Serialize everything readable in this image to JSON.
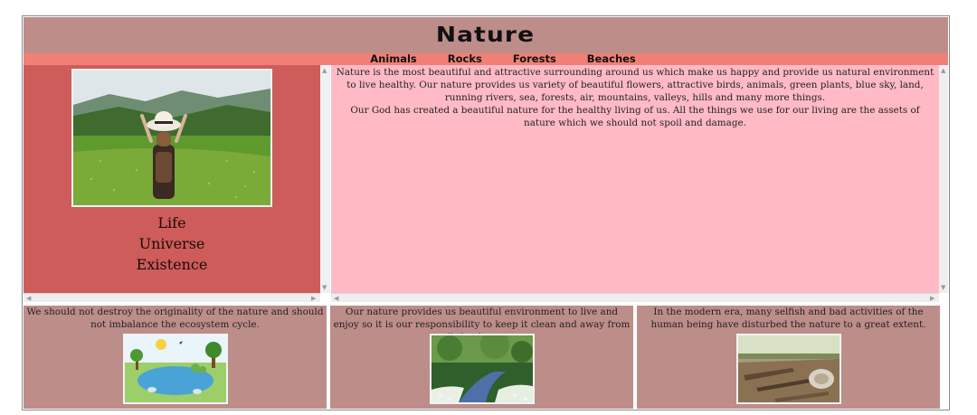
{
  "page": {
    "title": "Nature"
  },
  "nav": {
    "items": [
      "Animals",
      "Rocks",
      "Forests",
      "Beaches"
    ]
  },
  "left": {
    "image_icon": "woman-in-meadow-photo",
    "lines": [
      "Life",
      "Universe",
      "Existence"
    ]
  },
  "main": {
    "paragraph1": "Nature is the most beautiful and attractive surrounding around us which make us happy and provide us natural environment to live healthy. Our nature provides us variety of beautiful flowers, attractive birds, animals, green plants, blue sky, land, running rivers, sea, forests, air, mountains, valleys, hills and many more things.",
    "paragraph2": "Our God has created a beautiful nature for the healthy living of us. All the things we use for our living are the assets of nature which we should not spoil and damage."
  },
  "bottom": [
    {
      "text": "We should not destroy the originality of the nature and should not imbalance the ecosystem cycle.",
      "image_icon": "ecosystem-illustration"
    },
    {
      "text": "Our nature provides us beautiful environment to live and enjoy so it is our responsibility to keep it clean and away from all the damages.",
      "image_icon": "garden-stream-photo"
    },
    {
      "text": "In the modern era, many selfish and bad activities of the human being have disturbed the nature to a great extent.",
      "image_icon": "deforestation-photo"
    }
  ],
  "colors": {
    "title_bg": "#bd8d8a",
    "nav_bg": "#f08075",
    "left_bg": "#cd5c5a",
    "main_bg": "#ffbac6"
  }
}
